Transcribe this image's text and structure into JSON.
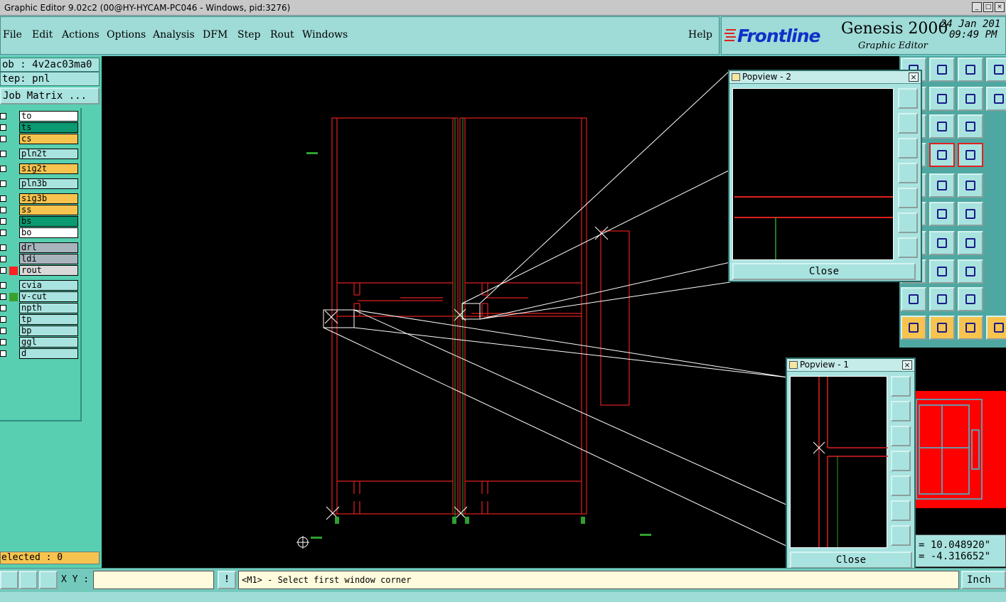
{
  "window": {
    "title": "Graphic Editor 9.02c2 (00@HY-HYCAM-PC046 - Windows, pid:3276)"
  },
  "menu": {
    "file": "File",
    "edit": "Edit",
    "actions": "Actions",
    "options": "Options",
    "analysis": "Analysis",
    "dfm": "DFM",
    "step": "Step",
    "rout": "Rout",
    "windows": "Windows",
    "help": "Help"
  },
  "brand": {
    "logo": "Frontline",
    "product": "Genesis 2000",
    "subtitle": "Graphic Editor",
    "date": "24 Jan 201",
    "time": "09:49 PM"
  },
  "job": {
    "job_line": "ob : 4v2ac03ma0",
    "step_line": "tep: pnl",
    "matrix_button": "Job Matrix ..."
  },
  "layers": [
    {
      "name": "to",
      "color": "#ffffff",
      "swatch": ""
    },
    {
      "name": "ts",
      "color": "#0b9a72",
      "swatch": ""
    },
    {
      "name": "cs",
      "color": "#f6c34f",
      "swatch": ""
    },
    {
      "name": "pln2t",
      "color": "#a9e3df",
      "swatch": ""
    },
    {
      "name": "sig2t",
      "color": "#f6c34f",
      "swatch": ""
    },
    {
      "name": "pln3b",
      "color": "#a9e3df",
      "swatch": ""
    },
    {
      "name": "sig3b",
      "color": "#f6c34f",
      "swatch": ""
    },
    {
      "name": "ss",
      "color": "#f6c34f",
      "swatch": ""
    },
    {
      "name": "bs",
      "color": "#0b9a72",
      "swatch": ""
    },
    {
      "name": "bo",
      "color": "#ffffff",
      "swatch": ""
    },
    {
      "name": "drl",
      "color": "#a8b4bc",
      "swatch": ""
    },
    {
      "name": "ldi",
      "color": "#a8b4bc",
      "swatch": ""
    },
    {
      "name": "rout",
      "color": "#d9d9d9",
      "swatch": "#ff2020"
    },
    {
      "name": "cvia",
      "color": "#a9e3df",
      "swatch": ""
    },
    {
      "name": "v-cut",
      "color": "#a9e3df",
      "swatch": "#3aa02a"
    },
    {
      "name": "npth",
      "color": "#a9e3df",
      "swatch": ""
    },
    {
      "name": "tp",
      "color": "#a9e3df",
      "swatch": ""
    },
    {
      "name": "bp",
      "color": "#a9e3df",
      "swatch": ""
    },
    {
      "name": "ggl",
      "color": "#a9e3df",
      "swatch": ""
    },
    {
      "name": "d",
      "color": "#a9e3df",
      "swatch": ""
    }
  ],
  "selection": {
    "text": "elected : 0"
  },
  "popview2": {
    "title": "Popview - 2",
    "close": "Close"
  },
  "popview1": {
    "title": "Popview - 1",
    "close": "Close"
  },
  "coords": {
    "x": "= 10.048920\"",
    "y": "= -4.316652\""
  },
  "status": {
    "xy_label": "X Y :",
    "xy_value": "",
    "warn": "!",
    "prompt": "<M1> - Select first window corner",
    "unit": "Inch"
  },
  "colors": {
    "canvas": "#000000",
    "outline": "#e02020",
    "vcut": "#2f9f2f",
    "zoomline": "#ffffff"
  }
}
